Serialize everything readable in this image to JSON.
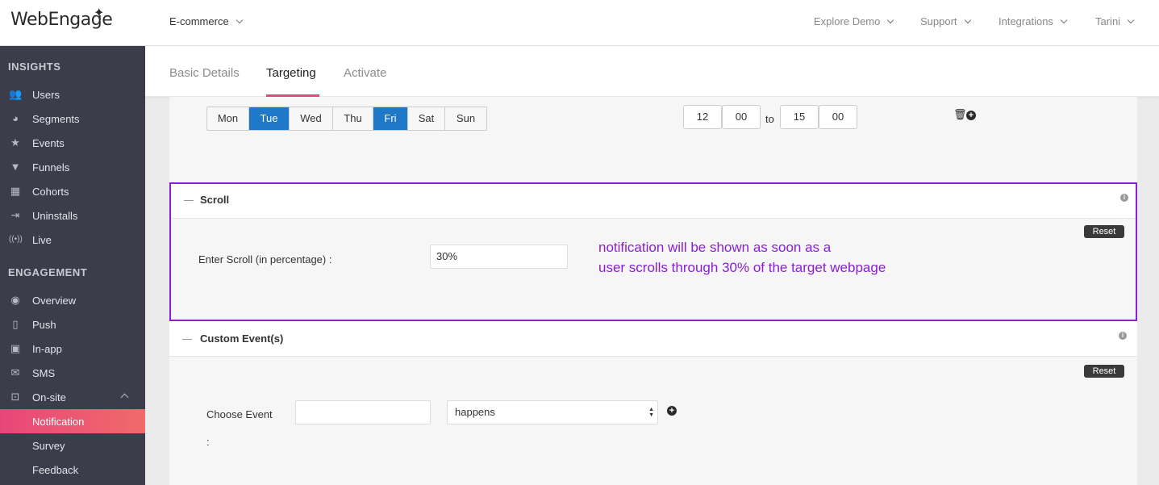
{
  "app": {
    "logo_text": "WebEngage",
    "project": "E-commerce"
  },
  "topnav": {
    "items": [
      "Explore Demo",
      "Support",
      "Integrations",
      "Tarini"
    ]
  },
  "sidebar": {
    "insights_header": "INSIGHTS",
    "insights": [
      {
        "label": "Users",
        "icon": "users-icon"
      },
      {
        "label": "Segments",
        "icon": "pie-chart-icon"
      },
      {
        "label": "Events",
        "icon": "events-icon"
      },
      {
        "label": "Funnels",
        "icon": "funnel-icon"
      },
      {
        "label": "Cohorts",
        "icon": "cohorts-icon"
      },
      {
        "label": "Uninstalls",
        "icon": "uninstall-icon"
      },
      {
        "label": "Live",
        "icon": "live-icon"
      }
    ],
    "engagement_header": "ENGAGEMENT",
    "engagement": [
      {
        "label": "Overview",
        "icon": "eye-icon"
      },
      {
        "label": "Push",
        "icon": "push-icon"
      },
      {
        "label": "In-app",
        "icon": "inapp-icon"
      },
      {
        "label": "SMS",
        "icon": "sms-icon"
      },
      {
        "label": "On-site",
        "icon": "onsite-icon"
      }
    ],
    "onsite_sub": [
      "Notification",
      "Survey",
      "Feedback"
    ],
    "active_item": "Notification"
  },
  "tabs": {
    "items": [
      "Basic Details",
      "Targeting",
      "Activate"
    ],
    "active": "Targeting"
  },
  "schedule": {
    "days": [
      "Mon",
      "Tue",
      "Wed",
      "Thu",
      "Fri",
      "Sat",
      "Sun"
    ],
    "selected_days": [
      "Tue",
      "Fri"
    ],
    "from_hour": "12",
    "from_min": "00",
    "to_label": "to",
    "to_hour": "15",
    "to_min": "00"
  },
  "scroll": {
    "title": "Scroll",
    "reset_label": "Reset",
    "field_label": "Enter Scroll (in percentage) :",
    "field_value": "30%",
    "annotation_line1": "notification will be shown as soon as a",
    "annotation_line2": "user scrolls through 30% of the target webpage"
  },
  "custom_event": {
    "title": "Custom Event(s)",
    "reset_label": "Reset",
    "choose_label": "Choose Event",
    "colon": ":",
    "event_value": "",
    "condition_value": "happens"
  },
  "colors": {
    "accent": "#e8467a",
    "selected_day": "#1f78c8",
    "highlight": "#8a1fd4",
    "sidebar_bg": "#3c3d4b"
  }
}
